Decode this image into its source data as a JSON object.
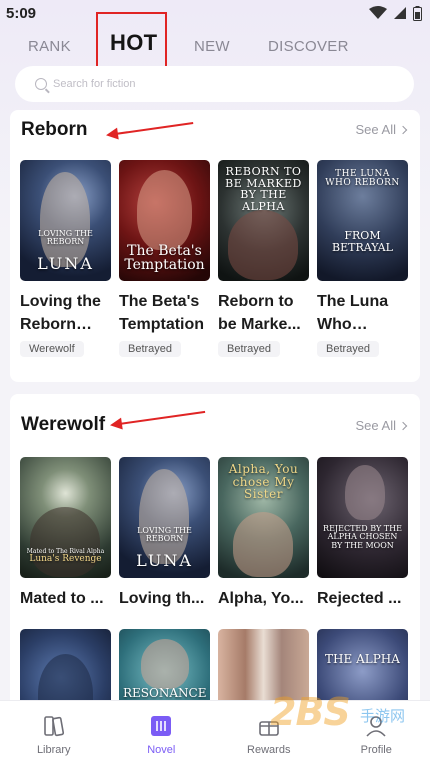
{
  "status": {
    "time": "5:09"
  },
  "tabs": [
    {
      "label": "RANK"
    },
    {
      "label": "HOT"
    },
    {
      "label": "NEW"
    },
    {
      "label": "DISCOVER"
    }
  ],
  "search": {
    "placeholder": "Search for fiction"
  },
  "sections": [
    {
      "title": "Reborn",
      "see_all": "See All",
      "books": [
        {
          "title": "Loving the Reborn Lu...",
          "tag": "Werewolf",
          "cover_text": "LUNA",
          "cover_top": "LOVING THE REBORN"
        },
        {
          "title": "The Beta's Temptation",
          "tag": "Betrayed",
          "cover_text": "The Beta's Temptation",
          "cover_top": ""
        },
        {
          "title": "Reborn to be Marke...",
          "tag": "Betrayed",
          "cover_text": "",
          "cover_top": "REBORN TO BE MARKED BY THE ALPHA"
        },
        {
          "title": "The Luna Who Rebo...",
          "tag": "Betrayed",
          "cover_text": "FROM BETRAYAL",
          "cover_top": "THE LUNA WHO REBORN"
        }
      ]
    },
    {
      "title": "Werewolf",
      "see_all": "See All",
      "books": [
        {
          "title": "Mated to ...",
          "cover_text": "Luna's Revenge",
          "cover_top": "Mated to The Rival Alpha"
        },
        {
          "title": "Loving th...",
          "cover_text": "LUNA",
          "cover_top": "LOVING THE REBORN"
        },
        {
          "title": "Alpha, Yo...",
          "cover_text": "",
          "cover_top": "Alpha, You chose My Sister"
        },
        {
          "title": "Rejected ...",
          "cover_text": "REJECTED BY THE ALPHA CHOSEN BY THE MOON",
          "cover_top": ""
        }
      ],
      "more_covers": [
        {
          "cover_text": ""
        },
        {
          "cover_text": "RESONANCE"
        },
        {
          "cover_text": ""
        },
        {
          "cover_text": "THE ALPHA",
          "cover_top": ""
        }
      ]
    }
  ],
  "nav": [
    {
      "label": "Library",
      "icon": "library-icon"
    },
    {
      "label": "Novel",
      "icon": "novel-icon"
    },
    {
      "label": "Rewards",
      "icon": "rewards-icon"
    },
    {
      "label": "Profile",
      "icon": "profile-icon"
    }
  ],
  "watermark": {
    "main": "2BS",
    "sub": "手游网"
  },
  "colors": {
    "accent": "#7b5cf5",
    "annotation": "#e02424"
  }
}
